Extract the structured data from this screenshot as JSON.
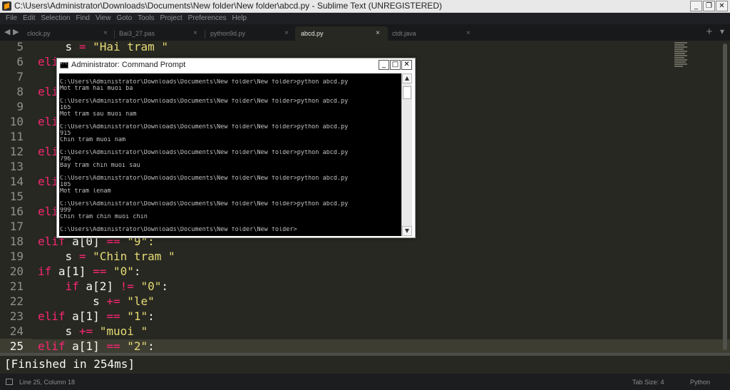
{
  "window": {
    "title": "C:\\Users\\Administrator\\Downloads\\Documents\\New folder\\New folder\\abcd.py - Sublime Text (UNREGISTERED)",
    "minimize": "_",
    "restore": "❐",
    "close": "✕"
  },
  "menu": [
    "File",
    "Edit",
    "Selection",
    "Find",
    "View",
    "Goto",
    "Tools",
    "Project",
    "Preferences",
    "Help"
  ],
  "tabs": [
    {
      "label": "clock.py",
      "close": "×"
    },
    {
      "label": "Bai3_27.pas",
      "close": "×"
    },
    {
      "label": "python9d.py",
      "close": "×"
    },
    {
      "label": "abcd.py",
      "close": "×",
      "active": true
    },
    {
      "label": "ctdt.java",
      "close": "×"
    }
  ],
  "tab_nav": {
    "prev": "◀",
    "next": "▶",
    "new_tab": "+",
    "tab_menu": "▾"
  },
  "editor": {
    "current_line": 25,
    "lines": [
      {
        "num": "5",
        "code": ""
      },
      {
        "num": "6",
        "code": "eli"
      },
      {
        "num": "7",
        "code": ""
      },
      {
        "num": "8",
        "code": "eli"
      },
      {
        "num": "9",
        "code": ""
      },
      {
        "num": "10",
        "code": "eli"
      },
      {
        "num": "11",
        "code": ""
      },
      {
        "num": "12",
        "code": "eli"
      },
      {
        "num": "13",
        "code": ""
      },
      {
        "num": "14",
        "code": "eli"
      },
      {
        "num": "15",
        "code": ""
      },
      {
        "num": "16",
        "code": "eli"
      },
      {
        "num": "17",
        "code": ""
      },
      {
        "num": "18",
        "code": ""
      },
      {
        "num": "19",
        "code": ""
      },
      {
        "num": "20",
        "code": ""
      },
      {
        "num": "21",
        "code": ""
      },
      {
        "num": "22",
        "code": ""
      },
      {
        "num": "23",
        "code": ""
      },
      {
        "num": "24",
        "code": ""
      },
      {
        "num": "25",
        "code": ""
      }
    ],
    "line5": {
      "indent": "    ",
      "var": "s",
      "op": "=",
      "str": "\"Hai tram \""
    },
    "line18": {
      "kw": "elif",
      "rest": " a[0] ",
      "op": "==",
      "str": " \"9\":"
    },
    "line19": {
      "indent": "    ",
      "var": "s",
      "op": "=",
      "str": "\"Chin tram \""
    },
    "line20": {
      "kw": "if",
      "rest": " a[1] ",
      "op": "==",
      "str": "\"0\"",
      "tail": ":"
    },
    "line21": {
      "indent": "    ",
      "kw": "if",
      "rest": " a[2] ",
      "op": "!=",
      "str": "\"0\"",
      "tail": ":"
    },
    "line22": {
      "indent": "        ",
      "var": "s",
      "op": "+=",
      "str": "\"le\""
    },
    "line23": {
      "kw": "elif",
      "rest": " a[1] ",
      "op": "==",
      "str": "\"1\"",
      "tail": ":"
    },
    "line24": {
      "indent": "    ",
      "var": "s",
      "op": "+=",
      "str": "\"muoi \""
    },
    "line25": {
      "kw": "elif",
      "rest": " a[1] ",
      "op": "==",
      "str": "\"2\"",
      "tail": ":"
    }
  },
  "output": {
    "text": "[Finished in 254ms]"
  },
  "status": {
    "position": "Line 25, Column 18",
    "tab_size": "Tab Size: 4",
    "syntax": "Python"
  },
  "cmd": {
    "title": "Administrator: Command Prompt",
    "minimize": "_",
    "maximize": "□",
    "close": "✕",
    "scroll_up": "▲",
    "scroll_down": "▼",
    "lines": [
      "C:\\Users\\Administrator\\Downloads\\Documents\\New folder\\New folder>python abcd.py",
      "Mot tram hai muoi ba",
      "",
      "C:\\Users\\Administrator\\Downloads\\Documents\\New folder\\New folder>python abcd.py",
      "165",
      "Mot tram sau muoi nam",
      "",
      "C:\\Users\\Administrator\\Downloads\\Documents\\New folder\\New folder>python abcd.py",
      "915",
      "Chin tram muoi nam",
      "",
      "C:\\Users\\Administrator\\Downloads\\Documents\\New folder\\New folder>python abcd.py",
      "796",
      "Bay tram chin muoi sau",
      "",
      "C:\\Users\\Administrator\\Downloads\\Documents\\New folder\\New folder>python abcd.py",
      "105",
      "Mot tram lenam",
      "",
      "C:\\Users\\Administrator\\Downloads\\Documents\\New folder\\New folder>python abcd.py",
      "999",
      "Chin tram chin muoi chin",
      "",
      "C:\\Users\\Administrator\\Downloads\\Documents\\New folder\\New folder>"
    ]
  }
}
